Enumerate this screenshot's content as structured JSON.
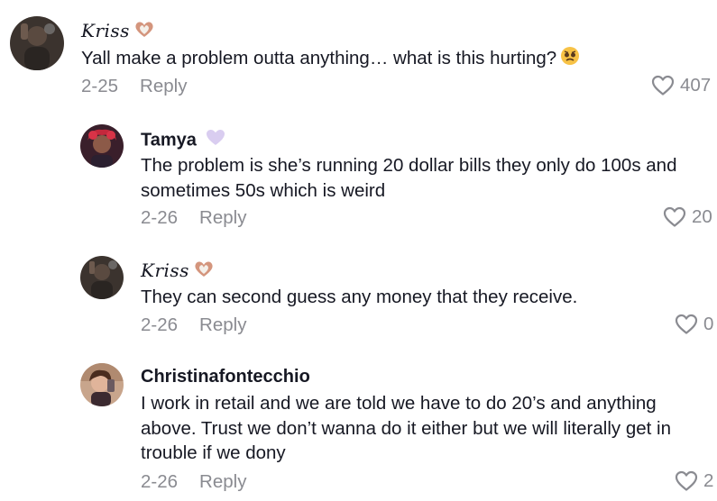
{
  "comments": [
    {
      "username": "Kriss",
      "text": "Yall make a problem outta anything… what is this hurting?",
      "date": "2-25",
      "reply_label": "Reply",
      "likes": "407",
      "name_emoji": "heart-hands-emoji",
      "text_emoji": "pleading-face-emoji"
    },
    {
      "username": "Tamya",
      "text": "The problem is she’s running 20 dollar bills they only do 100s and sometimes 50s which is weird",
      "date": "2-26",
      "reply_label": "Reply",
      "likes": "20",
      "name_emoji": "purple-heart-emoji"
    },
    {
      "username": "Kriss",
      "text": "They can second guess any money that they receive.",
      "date": "2-26",
      "reply_label": "Reply",
      "likes": "0",
      "name_emoji": "heart-hands-emoji"
    },
    {
      "username": "Christinafontecchio",
      "text": "I work in retail and we are told we have to do 20’s and anything above. Trust we don’t wanna do it either but we will literally get in trouble if we dony",
      "date": "2-26",
      "reply_label": "Reply",
      "likes": "2"
    }
  ],
  "colors": {
    "text": "#161823",
    "muted": "#8a8b91",
    "background": "#ffffff"
  }
}
